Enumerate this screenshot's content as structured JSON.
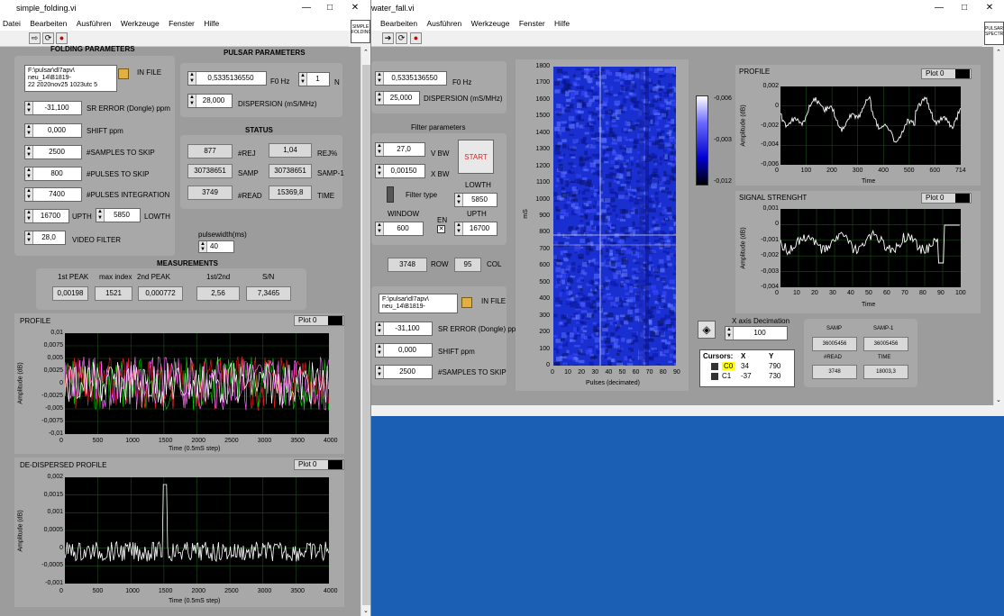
{
  "left": {
    "title": "simple_folding.vi",
    "menu": [
      "Datei",
      "Bearbeiten",
      "Ausführen",
      "Werkzeuge",
      "Fenster",
      "Hilfe"
    ],
    "corner_icon": "SIMPLE FOLDING",
    "folding": {
      "header": "FOLDING PARAMETERS",
      "infile_label": "IN FILE",
      "infile_lines": [
        "F:\\pulsar\\dl7apv\\",
        "neu_14\\B1819-",
        "22 2020nov25 1023utc 5"
      ],
      "sr_error": {
        "value": "-31,100",
        "label": "SR ERROR (Dongle) ppm"
      },
      "shift": {
        "value": "0,000",
        "label": "SHIFT ppm"
      },
      "samples_skip": {
        "value": "2500",
        "label": "#SAMPLES TO SKIP"
      },
      "pulses_skip": {
        "value": "800",
        "label": "#PULSES TO SKIP"
      },
      "pulses_int": {
        "value": "7400",
        "label": "#PULSES INTEGRATION"
      },
      "upth": {
        "value": "16700",
        "label": "UPTH"
      },
      "lowth": {
        "value": "5850",
        "label": "LOWTH"
      },
      "video": {
        "value": "28,0",
        "label": "VIDEO FILTER"
      }
    },
    "pulsar": {
      "header": "PULSAR PARAMETERS",
      "f0": {
        "value": "0,5335136550",
        "label": "F0 Hz"
      },
      "n": {
        "value": "1",
        "label": "N"
      },
      "dispersion": {
        "value": "28,000",
        "label": "DISPERSION (mS/MHz)"
      }
    },
    "status": {
      "header": "STATUS",
      "rej": {
        "value": "877",
        "label": "#REJ"
      },
      "rejpct": {
        "value": "1,04",
        "label": "REJ%"
      },
      "samp": {
        "value": "30738651",
        "label": "SAMP"
      },
      "samp1": {
        "value": "30738651",
        "label": "SAMP-1"
      },
      "read": {
        "value": "3749",
        "label": "#READ"
      },
      "time": {
        "value": "15369,8",
        "label": "TIME"
      }
    },
    "pulsewidth": {
      "label": "pulsewidth(ms)",
      "value": "40"
    },
    "measurements": {
      "header": "MEASUREMENTS",
      "peak1": {
        "label": "1st PEAK",
        "value": "0,00198"
      },
      "maxidx": {
        "label": "max index",
        "value": "1521"
      },
      "peak2": {
        "label": "2nd PEAK",
        "value": "0,000772"
      },
      "ratio": {
        "label": "1st/2nd",
        "value": "2,56"
      },
      "sn": {
        "label": "S/N",
        "value": "7,3465"
      }
    },
    "profile": {
      "title": "PROFILE",
      "legend": "Plot 0",
      "ylabel": "Amplitude (dB)",
      "xlabel": "Time (0.5mS step)",
      "yticks": [
        "0,01",
        "0,0075",
        "0,005",
        "0,0025",
        "0",
        "-0,0025",
        "-0,005",
        "-0,0075",
        "-0,01"
      ],
      "xticks": [
        "0",
        "500",
        "1000",
        "1500",
        "2000",
        "2500",
        "3000",
        "3500",
        "4000"
      ]
    },
    "dedisp": {
      "title": "DE-DISPERSED PROFILE",
      "legend": "Plot 0",
      "ylabel": "Amplitude (dB)",
      "xlabel": "Time (0.5mS step)",
      "yticks": [
        "0,002",
        "0,0015",
        "0,001",
        "0,0005",
        "0",
        "-0,0005",
        "-0,001"
      ],
      "xticks": [
        "0",
        "500",
        "1000",
        "1500",
        "2000",
        "2500",
        "3000",
        "3500",
        "4000"
      ]
    }
  },
  "right": {
    "title": "water_fall.vi",
    "menu": [
      "Bearbeiten",
      "Ausführen",
      "Werkzeuge",
      "Fenster",
      "Hilfe"
    ],
    "corner_icon": "PULSAR SPECTR",
    "f0": {
      "value": "0,5335136550",
      "label": "F0 Hz"
    },
    "dispersion": {
      "value": "25,000",
      "label": "DISPERSION (mS/MHz)"
    },
    "filter": {
      "header": "Filter parameters",
      "vbw": {
        "value": "27,0",
        "label": "V BW"
      },
      "xbw": {
        "value": "0,00150",
        "label": "X BW"
      },
      "start": "START",
      "filter_type": "Filter type",
      "lowth": {
        "label": "LOWTH",
        "value": "5850"
      },
      "window": {
        "label": "WINDOW",
        "value": "600"
      },
      "en": "EN",
      "upth": {
        "label": "UPTH",
        "value": "16700"
      }
    },
    "row": {
      "value": "3748",
      "label": "ROW"
    },
    "col": {
      "value": "95",
      "label": "COL"
    },
    "infile_label": "IN FILE",
    "infile_lines": [
      "F:\\pulsar\\dl7apv\\",
      "neu_14\\B1819-"
    ],
    "sr_error": {
      "value": "-31,100",
      "label": "SR ERROR (Dongle) ppm"
    },
    "shift": {
      "value": "0,000",
      "label": "SHIFT ppm"
    },
    "samples_skip": {
      "value": "2500",
      "label": "#SAMPLES TO SKIP"
    },
    "waterfall": {
      "ylabel": "mS",
      "xlabel": "Pulses (decimated)",
      "yticks": [
        "1800",
        "1700",
        "1600",
        "1500",
        "1400",
        "1300",
        "1200",
        "1100",
        "1000",
        "900",
        "800",
        "700",
        "600",
        "500",
        "400",
        "300",
        "200",
        "100",
        "0"
      ],
      "xticks": [
        "0",
        "10",
        "20",
        "30",
        "40",
        "50",
        "60",
        "70",
        "80",
        "90"
      ],
      "colorbar": [
        "-0,006",
        "-0,003",
        "-0,012"
      ]
    },
    "xdec": {
      "label": "X axis Decimation",
      "value": "100"
    },
    "cursors": {
      "header": [
        "Cursors:",
        "X",
        "Y"
      ],
      "rows": [
        {
          "name": "C0",
          "x": "34",
          "y": "790"
        },
        {
          "name": "C1",
          "x": "-37",
          "y": "730"
        }
      ]
    },
    "profile": {
      "title": "PROFILE",
      "legend": "Plot 0",
      "ylabel": "Amplitude (dB)",
      "xlabel": "Time",
      "yticks": [
        "0,002",
        "0",
        "-0,002",
        "-0,004",
        "-0,006"
      ],
      "xticks": [
        "0",
        "100",
        "200",
        "300",
        "400",
        "500",
        "600",
        "714"
      ]
    },
    "signal": {
      "title": "SIGNAL STRENGHT",
      "legend": "Plot 0",
      "ylabel": "Amplitude (dB)",
      "xlabel": "Time",
      "yticks": [
        "0,001",
        "0",
        "-0,001",
        "-0,002",
        "-0,003",
        "-0,004"
      ],
      "xticks": [
        "0",
        "10",
        "20",
        "30",
        "40",
        "50",
        "60",
        "70",
        "80",
        "90",
        "100"
      ]
    },
    "status": {
      "samp": {
        "label": "SAMP",
        "value": "36005456"
      },
      "samp1": {
        "label": "SAMP-1",
        "value": "36005456"
      },
      "read": {
        "label": "#READ",
        "value": "3748"
      },
      "time": {
        "label": "TIME",
        "value": "18003,3"
      }
    }
  }
}
